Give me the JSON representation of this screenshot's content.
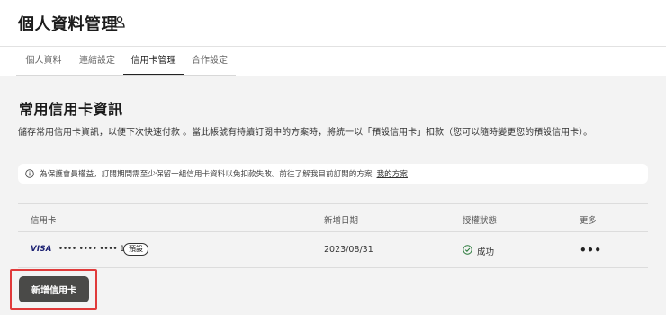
{
  "header": {
    "title": "個人資料管理",
    "icon": "person-icon"
  },
  "tabs": [
    {
      "label": "個人資料",
      "active": false
    },
    {
      "label": "連結設定",
      "active": false
    },
    {
      "label": "信用卡管理",
      "active": true
    },
    {
      "label": "合作設定",
      "active": false
    }
  ],
  "main": {
    "section_title": "常用信用卡資訊",
    "description": "儲存常用信用卡資訊，以便下次快速付款 。當此帳號有持續訂閱中的方案時，將統一以「預設信用卡」扣款（您可以隨時變更您的預設信用卡）。",
    "notice": {
      "icon": "info-icon",
      "text": "為保護會員權益，訂閱期間需至少保留一組信用卡資料以免扣款失敗。前往了解我目前訂閱的方案",
      "link": "我的方案"
    },
    "table": {
      "headers": {
        "card": "信用卡",
        "date": "新增日期",
        "status": "授權狀態",
        "more": "更多"
      },
      "rows": [
        {
          "brand": "VISA",
          "masked_number": "•••• •••• •••• 1111",
          "badge": "預設",
          "date": "2023/08/31",
          "status": "成功",
          "status_icon": "check-circle-icon",
          "more": "•••"
        }
      ]
    },
    "add_button": "新增信用卡",
    "colors": {
      "button_bg": "#4a4a48",
      "content_bg": "#f3f3f3",
      "highlight": "#e03a3a"
    }
  }
}
